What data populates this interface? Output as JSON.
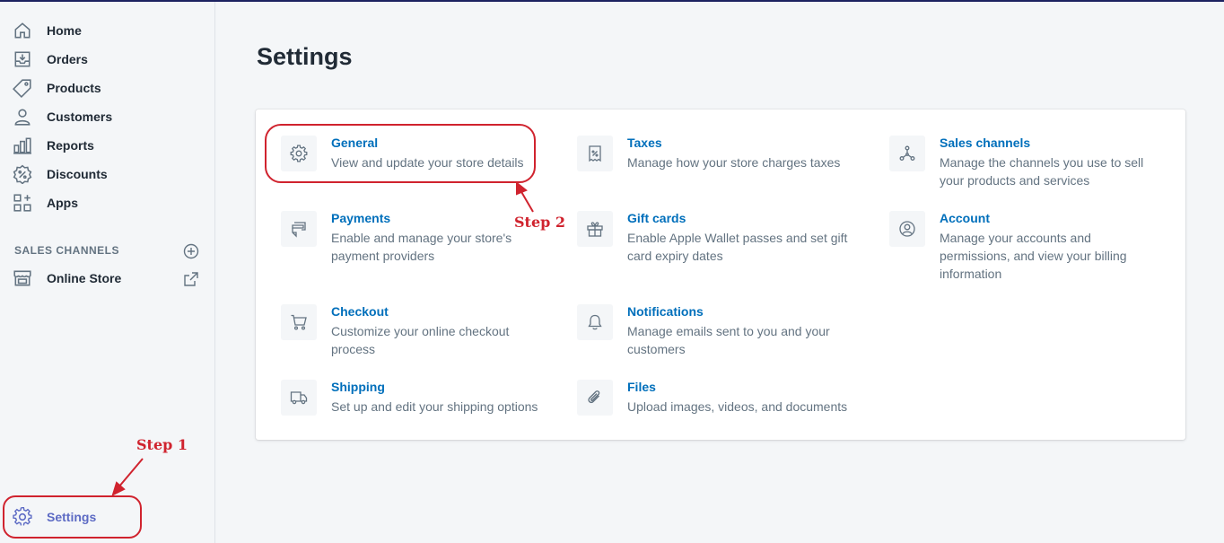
{
  "sidebar": {
    "items": [
      {
        "label": "Home",
        "icon": "home-icon"
      },
      {
        "label": "Orders",
        "icon": "orders-icon"
      },
      {
        "label": "Products",
        "icon": "tag-icon"
      },
      {
        "label": "Customers",
        "icon": "person-icon"
      },
      {
        "label": "Reports",
        "icon": "bar-chart-icon"
      },
      {
        "label": "Discounts",
        "icon": "discount-icon"
      },
      {
        "label": "Apps",
        "icon": "apps-icon"
      }
    ],
    "sales_channels_title": "SALES CHANNELS",
    "online_store_label": "Online Store",
    "settings_label": "Settings"
  },
  "main": {
    "page_title": "Settings",
    "settings": [
      {
        "title": "General",
        "description": "View and update your store details",
        "icon": "gear-icon"
      },
      {
        "title": "Taxes",
        "description": "Manage how your store charges taxes",
        "icon": "receipt-icon"
      },
      {
        "title": "Sales channels",
        "description": "Manage the channels you use to sell your products and services",
        "icon": "channels-icon"
      },
      {
        "title": "Payments",
        "description": "Enable and manage your store's payment providers",
        "icon": "payments-icon"
      },
      {
        "title": "Gift cards",
        "description": "Enable Apple Wallet passes and set gift card expiry dates",
        "icon": "gift-icon"
      },
      {
        "title": "Account",
        "description": "Manage your accounts and permissions, and view your billing information",
        "icon": "account-icon"
      },
      {
        "title": "Checkout",
        "description": "Customize your online checkout process",
        "icon": "cart-icon"
      },
      {
        "title": "Notifications",
        "description": "Manage emails sent to you and your customers",
        "icon": "bell-icon"
      },
      {
        "title": "Shipping",
        "description": "Set up and edit your shipping options",
        "icon": "truck-icon"
      },
      {
        "title": "Files",
        "description": "Upload images, videos, and documents",
        "icon": "paperclip-icon"
      }
    ]
  },
  "annotations": {
    "step1": "Step 1",
    "step2": "Step 2"
  },
  "colors": {
    "link": "#006fbb",
    "accent": "#5c6ac4",
    "annotation": "#d0232e"
  }
}
